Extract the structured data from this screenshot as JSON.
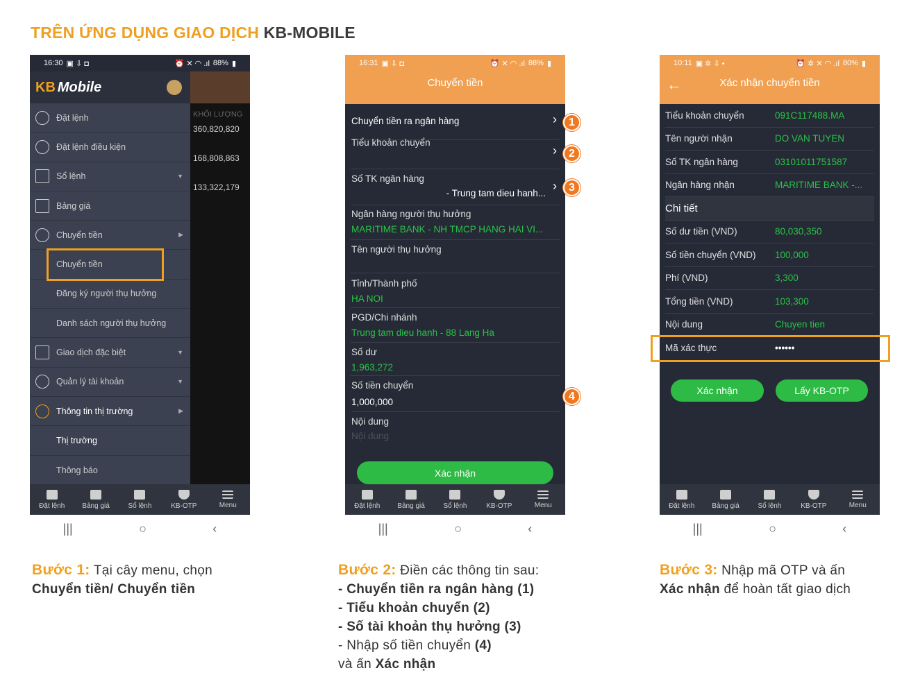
{
  "title": {
    "part1": "TRÊN ỨNG DỤNG GIAO DỊCH",
    "part2": "KB-MOBILE"
  },
  "phone1": {
    "status_time": "16:30",
    "status_battery": "88%",
    "logo": {
      "kb": "KB",
      "name": "Mobile"
    },
    "overlay_header": "KHỐI LƯỢNG",
    "overlay_values": [
      "360,820,820",
      "168,808,863",
      "133,322,179"
    ],
    "menu": [
      {
        "label": "Đặt lệnh"
      },
      {
        "label": "Đặt lệnh điều kiện"
      },
      {
        "label": "Sổ lệnh"
      },
      {
        "label": "Bảng giá"
      },
      {
        "label": "Chuyển tiền"
      },
      {
        "label": "Chuyển tiền"
      },
      {
        "label": "Đăng ký người thụ hưởng"
      },
      {
        "label": "Danh sách người thụ hưởng"
      },
      {
        "label": "Giao dịch đặc biệt"
      },
      {
        "label": "Quản lý tài khoản"
      },
      {
        "label": "Thông tin thị trường"
      },
      {
        "label": "Thị trường"
      },
      {
        "label": "Thông báo"
      }
    ]
  },
  "tabbar": [
    "Đặt lệnh",
    "Bảng giá",
    "Sổ lệnh",
    "KB-OTP",
    "Menu"
  ],
  "phone2": {
    "status_time": "16:31",
    "status_battery": "88%",
    "header": "Chuyển tiền",
    "row_transfer_type": "Chuyển tiền ra ngân hàng",
    "row_sub_account": "Tiểu khoản chuyển",
    "row_bank_account": "Số TK ngân hàng",
    "row_bank_account_value": "- Trung tam dieu hanh...",
    "row_bank_label": "Ngân hàng người thụ hưởng",
    "row_bank_value": "MARITIME BANK - NH TMCP HANG HAI VI...",
    "row_beneficiary": "Tên người thụ hưởng",
    "row_city_label": "Tỉnh/Thành phố",
    "row_city_value": "HA NOI",
    "row_branch_label": "PGD/Chi nhánh",
    "row_branch_value": "Trung tam dieu hanh - 88 Lang Ha",
    "row_balance_label": "Số dư",
    "row_balance_value": "1,963,272",
    "row_amount_label": "Số tiền chuyển",
    "row_amount_value": "1,000,000",
    "row_content_label": "Nội dung",
    "row_content_placeholder": "Nội dung",
    "confirm": "Xác nhận",
    "badges": [
      "1",
      "2",
      "3",
      "4"
    ]
  },
  "phone3": {
    "status_time": "10:11",
    "status_battery": "80%",
    "header": "Xác nhận chuyển tiền",
    "rows": [
      {
        "k": "Tiểu khoản chuyển",
        "v": "091C117488.MA"
      },
      {
        "k": "Tên người nhận",
        "v": "DO VAN TUYEN"
      },
      {
        "k": "Số TK ngân hàng",
        "v": "03101011751587"
      },
      {
        "k": "Ngân hàng nhận",
        "v": "MARITIME BANK -..."
      }
    ],
    "detail_header": "Chi tiết",
    "detail_rows": [
      {
        "k": "Số dư tiền (VND)",
        "v": "80,030,350"
      },
      {
        "k": "Số tiền chuyển (VND)",
        "v": "100,000"
      },
      {
        "k": "Phí (VND)",
        "v": "3,300"
      },
      {
        "k": "Tổng tiền (VND)",
        "v": "103,300"
      },
      {
        "k": "Nội dung",
        "v": "Chuyen tien"
      },
      {
        "k": "Mã xác thực",
        "v": "••••••"
      }
    ],
    "confirm": "Xác nhận",
    "get_otp": "Lấy KB-OTP"
  },
  "steps": {
    "s1_head": "Bước 1:",
    "s1_text": " Tại cây menu, chọn",
    "s1_bold": "Chuyển tiền/ Chuyển tiền",
    "s2_head": "Bước 2:",
    "s2_text": " Điền các thông tin sau:",
    "s2_l1": "- Chuyển tiền ra ngân hàng (1)",
    "s2_l2": "- Tiểu khoản chuyển  (2)",
    "s2_l3": "- Số tài khoản thụ hưởng (3)",
    "s2_l4a": "- Nhập số tiền chuyển ",
    "s2_l4b": "(4)",
    "s2_l5a": "và ấn ",
    "s2_l5b": "Xác nhận",
    "s3_head": "Bước 3:",
    "s3_text": " Nhập mã OTP và ấn",
    "s3_bold": "Xác nhận",
    "s3_rest": " để hoàn tất giao dịch"
  }
}
